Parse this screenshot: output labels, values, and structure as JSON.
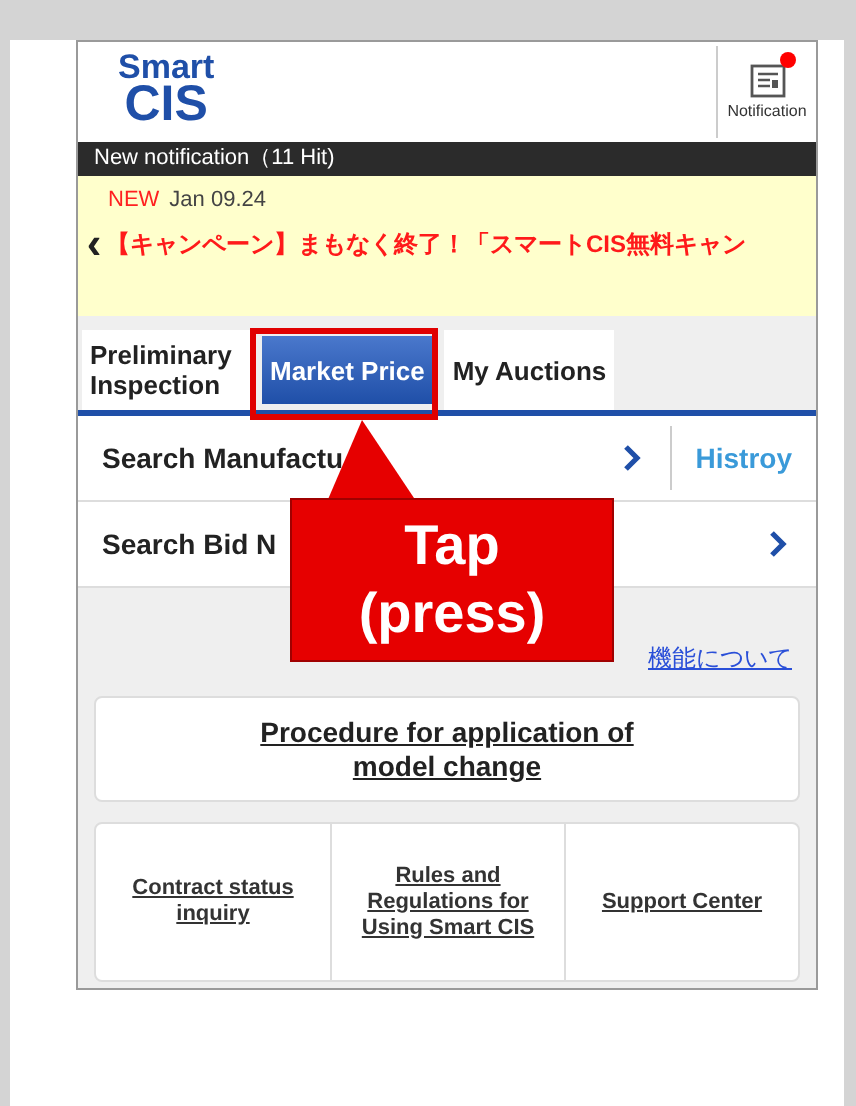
{
  "header": {
    "logo_top": "Smart",
    "logo_bottom": "CIS",
    "notification_label": "Notification",
    "has_unread": true
  },
  "notice_bar": {
    "title": "New notification（11 Hit)"
  },
  "notice": {
    "badge": "NEW",
    "date": "Jan 09.24",
    "prev": "‹",
    "message": "【キャンペーン】まもなく終了！「スマートCIS無料キャン"
  },
  "tabs": [
    {
      "label": "Preliminary Inspection",
      "selected": false
    },
    {
      "label": "Market Price",
      "selected": true
    },
    {
      "label": "My Auctions",
      "selected": false
    }
  ],
  "rows": [
    {
      "label": "Search Manufactu",
      "side_link": "Histroy"
    },
    {
      "label": "Search Bid N"
    }
  ],
  "info_link": "機能について",
  "procedure_button": "Procedure for application of model change",
  "footer_links": [
    "Contract status inquiry",
    "Rules and Regulations for Using Smart CIS",
    "Support Center"
  ],
  "callout": {
    "lines": [
      "Tap",
      "(press)"
    ]
  }
}
